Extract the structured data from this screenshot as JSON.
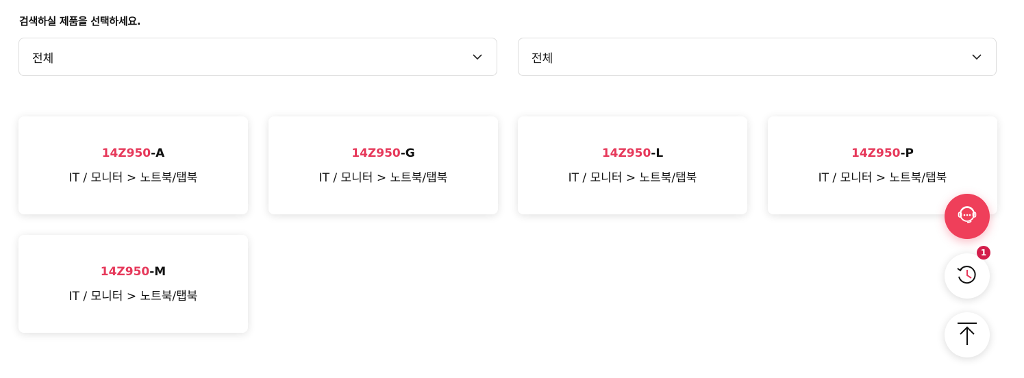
{
  "search": {
    "prompt": "검색하실 제품을 선택하세요.",
    "select1": {
      "value": "전체"
    },
    "select2": {
      "value": "전체"
    }
  },
  "results": [
    {
      "highlight": "14Z950",
      "suffix": "-A",
      "category": "IT / 모니터 > 노트북/탭북"
    },
    {
      "highlight": "14Z950",
      "suffix": "-G",
      "category": "IT / 모니터 > 노트북/탭북"
    },
    {
      "highlight": "14Z950",
      "suffix": "-L",
      "category": "IT / 모니터 > 노트북/탭북"
    },
    {
      "highlight": "14Z950",
      "suffix": "-P",
      "category": "IT / 모니터 > 노트북/탭북"
    },
    {
      "highlight": "14Z950",
      "suffix": "-M",
      "category": "IT / 모니터 > 노트북/탭북"
    }
  ],
  "floating": {
    "chat_icon": "chat-support-icon",
    "history_icon": "history-clock-icon",
    "history_badge": "1",
    "top_icon": "arrow-to-top-icon"
  },
  "colors": {
    "accent": "#e6385a",
    "chat_button": "#ef3f5a",
    "badge": "#d31d4b"
  }
}
